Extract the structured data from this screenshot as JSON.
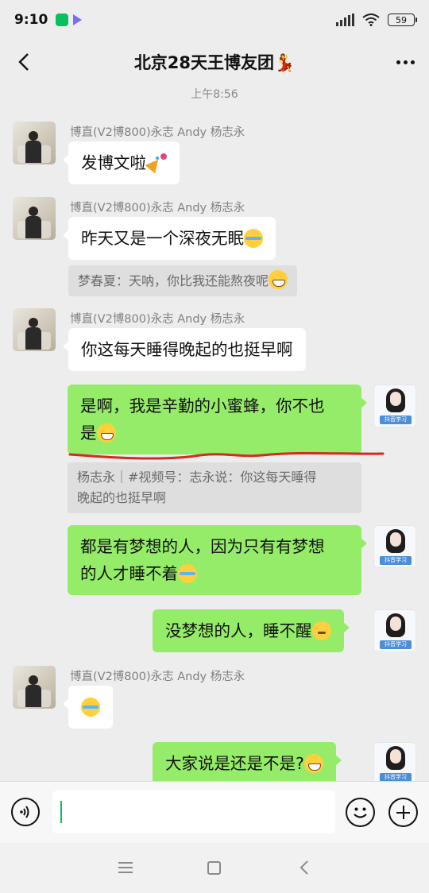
{
  "status_bar": {
    "time": "9:10",
    "battery": "59"
  },
  "header": {
    "title": "北京28天王博友团💃"
  },
  "timestamp": "上午8:56",
  "messages": [
    {
      "sender": "博直(V2博800)永志 Andy   杨志永",
      "text": "发博文啦",
      "emoji": "party-popper-icon"
    },
    {
      "sender": "博直(V2博800)永志 Andy   杨志永",
      "text": "昨天又是一个深夜无眠",
      "emoji": "crying-laughing-icon",
      "quote": "梦春夏：天呐，你比我还能熬夜呢"
    },
    {
      "sender": "博直(V2博800)永志 Andy   杨志永",
      "text": "你这每天睡得晚起的也挺早啊"
    },
    {
      "self": true,
      "line1": "是啊，我是辛勤的小蜜蜂，你不也",
      "line2": "是",
      "emoji": "grinning-icon",
      "quote_line1": "杨志永｜#视频号：志永说：你这每天睡得",
      "quote_line2": "晚起的也挺早啊",
      "avatar_badge": "抖音学习"
    },
    {
      "self": true,
      "line1": "都是有梦想的人，因为只有有梦想",
      "line2": "的人才睡不着",
      "emoji": "crying-laughing-icon",
      "avatar_badge": "抖音学习"
    },
    {
      "self": true,
      "text": "没梦想的人，睡不醒",
      "emoji": "thinking-face-icon",
      "avatar_badge": "抖音学习"
    },
    {
      "sender": "博直(V2博800)永志 Andy   杨志永",
      "emoji": "crying-laughing-icon"
    },
    {
      "self": true,
      "text": "大家说是还是不是?",
      "emoji": "grinning-icon",
      "avatar_badge": "抖音学习"
    }
  ],
  "colors": {
    "outgoing_bubble": "#95ec69",
    "incoming_bubble": "#ffffff",
    "background": "#ededed",
    "annotation": "#d42a1f",
    "caret": "#07c160"
  },
  "icons": [
    "back-arrow-icon",
    "more-dots-icon",
    "voice-icon",
    "emoji-icon",
    "plus-icon",
    "nav-menu-icon",
    "nav-home-icon",
    "nav-back-icon"
  ]
}
